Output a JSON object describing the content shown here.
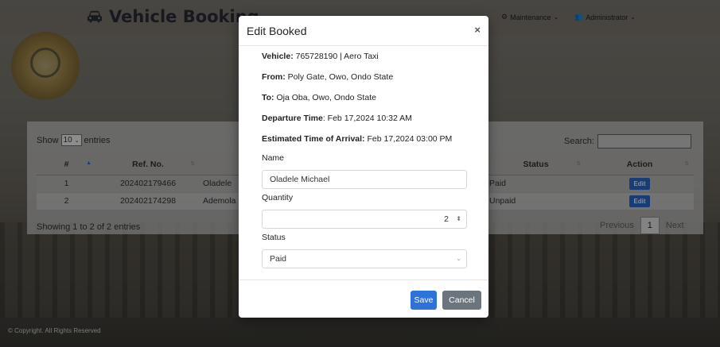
{
  "app": {
    "brand": "Vehicle Booking"
  },
  "nav": [
    {
      "label": "Maintenance",
      "icon": "gear-icon"
    },
    {
      "label": "Administrator",
      "icon": "users-icon"
    }
  ],
  "table": {
    "show_label": "Show",
    "page_size": "10",
    "entries_label": "entries",
    "search_label": "Search:",
    "columns": [
      "#",
      "Ref. No.",
      "",
      "Status",
      "Action"
    ],
    "rows": [
      {
        "num": "1",
        "ref": "202402179466",
        "name": "Oladele",
        "status": "Paid",
        "action": "Edit"
      },
      {
        "num": "2",
        "ref": "202402174298",
        "name": "Ademola",
        "status": "Unpaid",
        "action": "Edit"
      }
    ],
    "info": "Showing 1 to 2 of 2 entries",
    "pager": {
      "previous": "Previous",
      "current": "1",
      "next": "Next"
    }
  },
  "footer": "© Copyright. All Rights Reserved",
  "modal": {
    "title": "Edit Booked",
    "close": "×",
    "details": [
      {
        "label": "Vehicle:",
        "value": " 765728190 | Aero Taxi"
      },
      {
        "label": "From:",
        "value": " Poly Gate, Owo, Ondo State"
      },
      {
        "label": "To:",
        "value": " Oja Oba, Owo, Ondo State"
      },
      {
        "label": "Departure Time",
        "value": ": Feb 17,2024 10:32 AM"
      },
      {
        "label": "Estimated Time of Arrival:",
        "value": " Feb 17,2024 03:00 PM"
      }
    ],
    "name_label": "Name",
    "name_value": "Oladele Michael",
    "quantity_label": "Quantity",
    "quantity_value": "2",
    "status_label": "Status",
    "status_value": "Paid",
    "save": "Save",
    "cancel": "Cancel"
  }
}
